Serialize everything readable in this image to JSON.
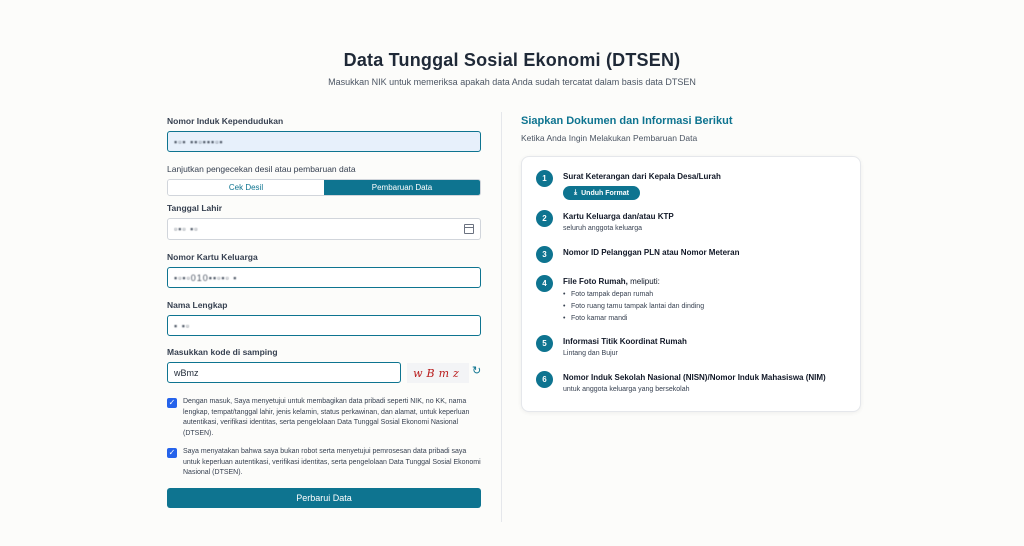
{
  "header": {
    "title": "Data Tunggal Sosial Ekonomi (DTSEN)",
    "subtitle": "Masukkan NIK untuk memeriksa apakah data Anda sudah tercatat dalam basis data DTSEN"
  },
  "form": {
    "nik_label": "Nomor Induk Kependudukan",
    "nik_value": "▪▫▪ ▪▪▫▪▪▪▫▪",
    "continue_label": "Lanjutkan pengecekan desil atau pembaruan data",
    "tabs": [
      {
        "label": "Cek Desil",
        "active": false
      },
      {
        "label": "Pembaruan Data",
        "active": true
      }
    ],
    "dob_label": "Tanggal Lahir",
    "dob_value": "▫▪▫ ▪▫",
    "kk_label": "Nomor Kartu Keluarga",
    "kk_value": "▪▫▪▫010▪▪▫▪▫ ▪",
    "name_label": "Nama Lengkap",
    "name_value": "▪ ▪▫",
    "captcha_label": "Masukkan kode di samping",
    "captcha_value": "wBmz",
    "captcha_image_text": "wBmz",
    "consent_1": "Dengan masuk, Saya menyetujui untuk membagikan data pribadi seperti NIK, no KK, nama lengkap, tempat/tanggal lahir, jenis kelamin, status perkawinan, dan alamat, untuk keperluan autentikasi, verifikasi identitas, serta pengelolaan Data Tunggal Sosial Ekonomi Nasional (DTSEN).",
    "consent_2": "Saya menyatakan bahwa saya bukan robot serta menyetujui pemrosesan data pribadi saya untuk keperluan autentikasi, verifikasi identitas, serta pengelolaan Data Tunggal Sosial Ekonomi Nasional (DTSEN).",
    "submit_label": "Perbarui Data"
  },
  "docs": {
    "title": "Siapkan Dokumen dan Informasi Berikut",
    "subtitle": "Ketika Anda Ingin Melakukan Pembaruan Data",
    "steps": [
      {
        "num": "1",
        "title": "Surat Keterangan dari Kepala Desa/Lurah",
        "button": "Unduh Format"
      },
      {
        "num": "2",
        "title": "Kartu Keluarga dan/atau KTP",
        "desc": "seluruh anggota keluarga"
      },
      {
        "num": "3",
        "title": "Nomor ID Pelanggan PLN atau Nomor Meteran"
      },
      {
        "num": "4",
        "title": "File Foto Rumah,",
        "title_suffix": " meliputi:",
        "bullets": [
          "Foto tampak depan rumah",
          "Foto ruang tamu tampak lantai dan dinding",
          "Foto kamar mandi"
        ]
      },
      {
        "num": "5",
        "title": "Informasi Titik Koordinat Rumah",
        "desc": "Lintang dan Bujur"
      },
      {
        "num": "6",
        "title": "Nomor Induk Sekolah Nasional (NISN)/Nomor Induk Mahasiswa (NIM)",
        "desc": "untuk anggota keluarga yang bersekolah"
      }
    ]
  },
  "colors": {
    "accent": "#0e7490",
    "checkbox": "#2563eb",
    "input_fill": "#e7f0fb"
  }
}
